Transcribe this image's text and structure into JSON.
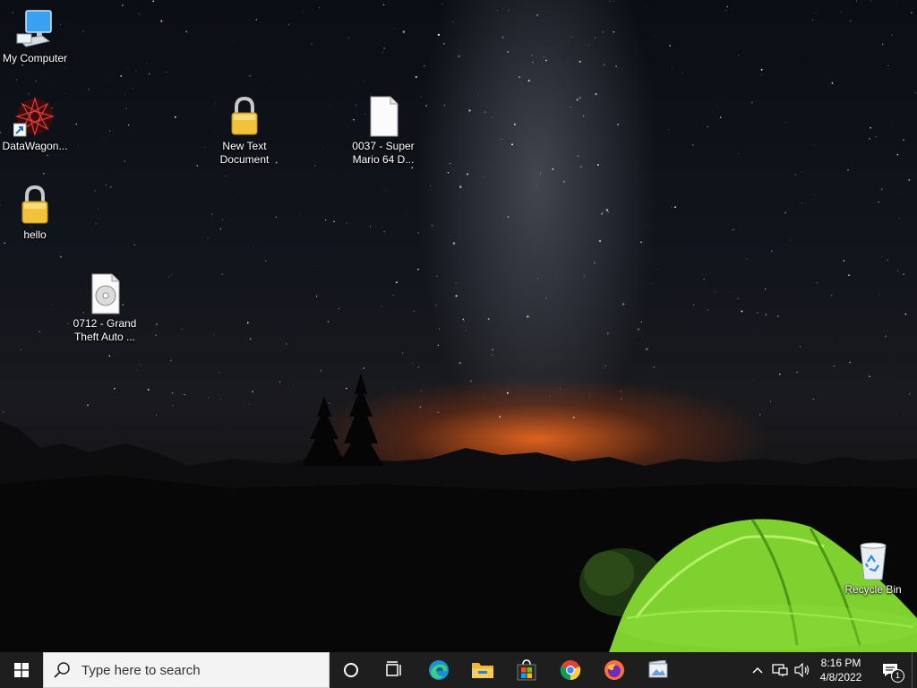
{
  "desktop": {
    "icons": [
      {
        "label": "My Computer",
        "icon": "computer-icon"
      },
      {
        "label": "DataWagon...",
        "icon": "datawagon-shortcut-icon"
      },
      {
        "label": "hello",
        "icon": "lock-icon"
      },
      {
        "label": "0712 - Grand Theft Auto ...",
        "icon": "disc-image-file-icon"
      },
      {
        "label": "New Text Document",
        "icon": "lock-icon"
      },
      {
        "label": "0037 - Super Mario 64 D...",
        "icon": "blank-file-icon"
      },
      {
        "label": "Recycle Bin",
        "icon": "recycle-bin-icon"
      }
    ]
  },
  "taskbar": {
    "search_placeholder": "Type here to search",
    "apps": [
      {
        "name": "Cortana",
        "icon": "cortana-icon"
      },
      {
        "name": "Task View",
        "icon": "task-view-icon"
      },
      {
        "name": "Microsoft Edge",
        "icon": "edge-icon"
      },
      {
        "name": "File Explorer",
        "icon": "folder-icon"
      },
      {
        "name": "Microsoft Store",
        "icon": "store-icon"
      },
      {
        "name": "Google Chrome",
        "icon": "chrome-icon"
      },
      {
        "name": "Firefox",
        "icon": "firefox-icon"
      },
      {
        "name": "Photo Viewer",
        "icon": "photo-viewer-icon"
      }
    ],
    "tray": {
      "time": "8:16 PM",
      "date": "4/8/2022",
      "notification_count": "1"
    }
  },
  "colors": {
    "taskbar_bg": "#1e1e1e",
    "search_bg": "#f3f3f3",
    "tent_green": "#8fe33a"
  }
}
